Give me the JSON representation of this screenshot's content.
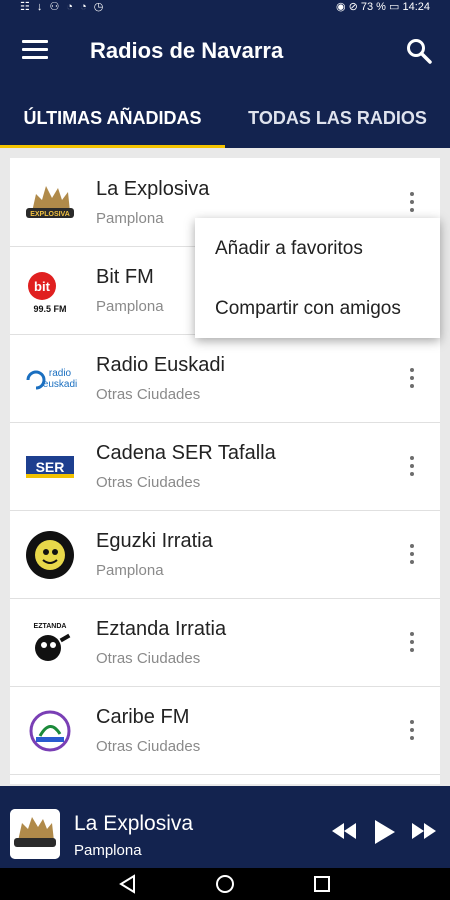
{
  "status": {
    "left_icons": "☷ ↓ ⚇ ◔ ◔ ◷",
    "right": "◉ ⊘ 73 % ▭ 14:24"
  },
  "appbar": {
    "title": "Radios de Navarra",
    "menu_icon": "menu-icon",
    "search_icon": "search-icon"
  },
  "tabs": [
    {
      "label": "ÚLTIMAS AÑADIDAS"
    },
    {
      "label": "TODAS LAS RADIOS"
    }
  ],
  "radios": [
    {
      "name": "La Explosiva",
      "city": "Pamplona"
    },
    {
      "name": "Bit FM",
      "city": "Pamplona"
    },
    {
      "name": "Radio Euskadi",
      "city": "Otras Ciudades"
    },
    {
      "name": "Cadena SER Tafalla",
      "city": "Otras Ciudades"
    },
    {
      "name": "Eguzki Irratia",
      "city": "Pamplona"
    },
    {
      "name": "Eztanda Irratia",
      "city": "Otras Ciudades"
    },
    {
      "name": "Caribe FM",
      "city": "Otras Ciudades"
    }
  ],
  "logos": {
    "explosiva": "EXPLOSIVA",
    "bit": "bit",
    "bit_sub": "99.5 FM",
    "euskadi1": "radio",
    "euskadi2": "euskadi",
    "ser": "SER",
    "eztanda": "EZTANDA"
  },
  "popup": {
    "favorites": "Añadir a favoritos",
    "share": "Compartir con amigos"
  },
  "player": {
    "name": "La Explosiva",
    "city": "Pamplona"
  },
  "colors": {
    "primary": "#13234f",
    "accent": "#f5c400"
  }
}
